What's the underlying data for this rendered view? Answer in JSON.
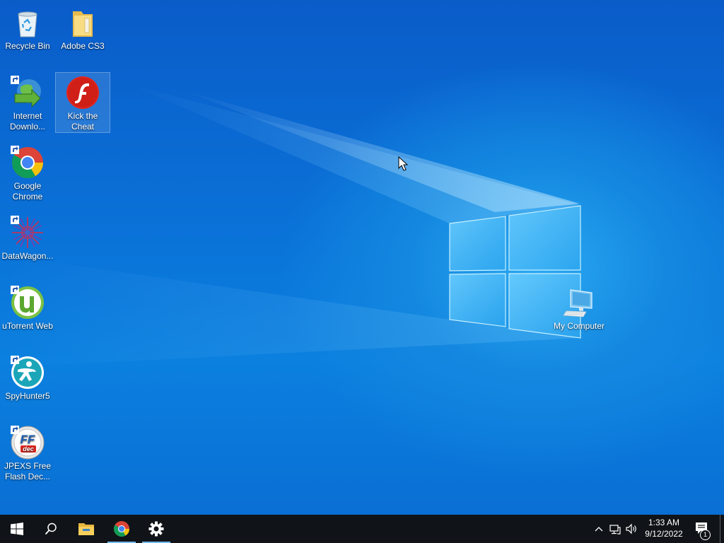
{
  "desktop": {
    "icons": [
      {
        "label": "Recycle Bin",
        "icon": "recycle-bin-icon"
      },
      {
        "label": "Adobe CS3",
        "icon": "folder-icon"
      },
      {
        "label": "Internet\nDownlo...",
        "icon": "internet-download-manager-icon"
      },
      {
        "label": "Kick the\nCheat",
        "icon": "flash-player-icon"
      },
      {
        "label": "Google\nChrome",
        "icon": "chrome-icon"
      },
      {
        "label": "DataWagon...",
        "icon": "datawagon-icon"
      },
      {
        "label": "uTorrent Web",
        "icon": "utorrent-icon"
      },
      {
        "label": "SpyHunter5",
        "icon": "spyhunter-icon"
      },
      {
        "label": "JPEXS Free\nFlash Dec...",
        "icon": "jpexs-ffdec-icon"
      },
      {
        "label": "My Computer",
        "icon": "my-computer-icon"
      }
    ],
    "ffdec_glyph_top": "FF",
    "ffdec_glyph_bottom": "dec"
  },
  "taskbar": {
    "buttons": [
      {
        "name": "start",
        "icon": "windows-logo-icon"
      },
      {
        "name": "search",
        "icon": "search-icon"
      },
      {
        "name": "file-explorer",
        "icon": "file-explorer-icon"
      },
      {
        "name": "chrome",
        "icon": "chrome-icon"
      },
      {
        "name": "settings",
        "icon": "gear-icon"
      }
    ],
    "tray": {
      "time": "1:33 AM",
      "date": "9/12/2022",
      "notification_count": "1"
    }
  },
  "colors": {
    "taskbar": "#101418",
    "desktop_accent": "#0a72d8",
    "running_indicator": "#76b9ed"
  }
}
